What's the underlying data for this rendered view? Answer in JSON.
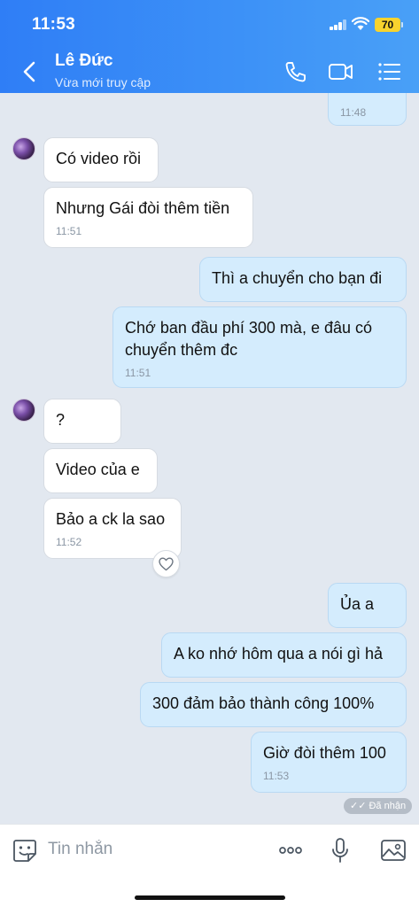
{
  "status_bar": {
    "time": "11:53",
    "battery": "70"
  },
  "header": {
    "name": "Lê Đức",
    "status": "Vừa mới truy cập",
    "icons": [
      "back-chevron-icon",
      "phone-icon",
      "video-call-icon",
      "menu-list-icon"
    ]
  },
  "messages": [
    {
      "dir": "out",
      "text": "",
      "time": "11:48"
    },
    {
      "dir": "in",
      "text": "Có video rồi",
      "time": ""
    },
    {
      "dir": "in",
      "text": "Nhưng Gái đòi thêm tiền",
      "time": "11:51"
    },
    {
      "dir": "out",
      "text": "Thì a chuyển cho bạn đi",
      "time": ""
    },
    {
      "dir": "out",
      "text": "Chớ ban đầu phí 300 mà, e đâu có chuyển thêm đc",
      "time": "11:51"
    },
    {
      "dir": "in",
      "text": "?",
      "time": ""
    },
    {
      "dir": "in",
      "text": "Video của e",
      "time": ""
    },
    {
      "dir": "in",
      "text": "Bảo a ck la sao",
      "time": "11:52"
    },
    {
      "dir": "out",
      "text": "Ủa a",
      "time": ""
    },
    {
      "dir": "out",
      "text": "A ko nhớ hôm qua a nói gì hả",
      "time": ""
    },
    {
      "dir": "out",
      "text": "300 đảm bảo thành công 100%",
      "time": ""
    },
    {
      "dir": "out",
      "text": "Giờ đòi thêm 100",
      "time": "11:53"
    }
  ],
  "received_label": "✓✓ Đã nhận",
  "input": {
    "placeholder": "Tin nhắn",
    "value": ""
  },
  "input_icons": [
    "sticker-icon",
    "more-icon",
    "microphone-icon",
    "image-icon"
  ],
  "colors": {
    "header": "#3d92f7",
    "out_bubble": "#d4ecfd",
    "in_bubble": "#ffffff",
    "background": "#e2e8f0"
  }
}
